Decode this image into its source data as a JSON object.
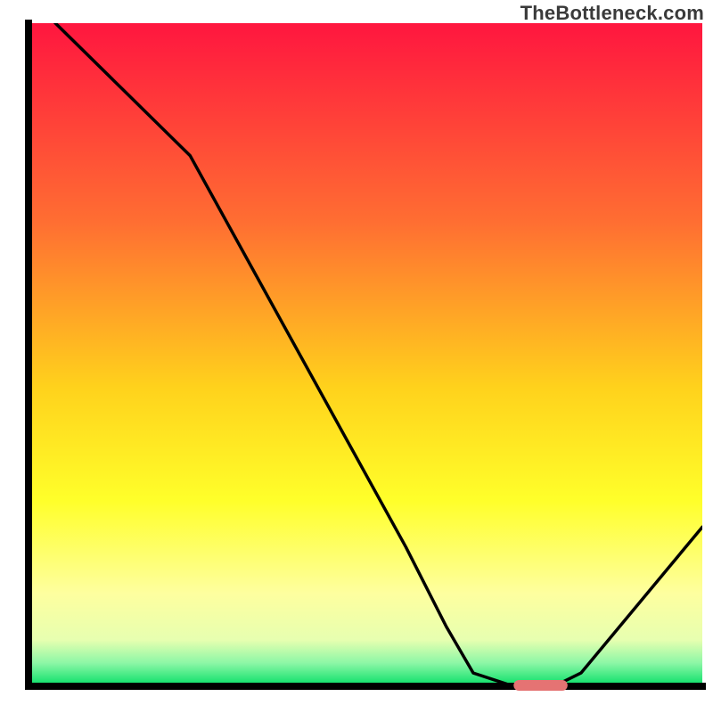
{
  "watermark": "TheBottleneck.com",
  "chart_data": {
    "type": "line",
    "title": "",
    "xlabel": "",
    "ylabel": "",
    "xlim": [
      0,
      100
    ],
    "ylim": [
      0,
      100
    ],
    "x": [
      0,
      4,
      14,
      24,
      56,
      62,
      66,
      72,
      78,
      82,
      100
    ],
    "values": [
      105,
      100,
      90,
      80,
      21,
      9,
      2,
      0,
      0,
      2,
      24
    ],
    "marker_segment": {
      "x_start": 72,
      "x_end": 80,
      "y": 0
    },
    "background_gradient_stops": [
      {
        "offset": 0.0,
        "color": "#ff163f"
      },
      {
        "offset": 0.3,
        "color": "#ff6e32"
      },
      {
        "offset": 0.55,
        "color": "#ffd21c"
      },
      {
        "offset": 0.72,
        "color": "#ffff2a"
      },
      {
        "offset": 0.86,
        "color": "#feff9f"
      },
      {
        "offset": 0.93,
        "color": "#e7ffb0"
      },
      {
        "offset": 0.965,
        "color": "#8cf7a6"
      },
      {
        "offset": 1.0,
        "color": "#05de66"
      }
    ],
    "axis_color": "#000000",
    "line_color": "#000000",
    "marker_color": "#e57373"
  }
}
